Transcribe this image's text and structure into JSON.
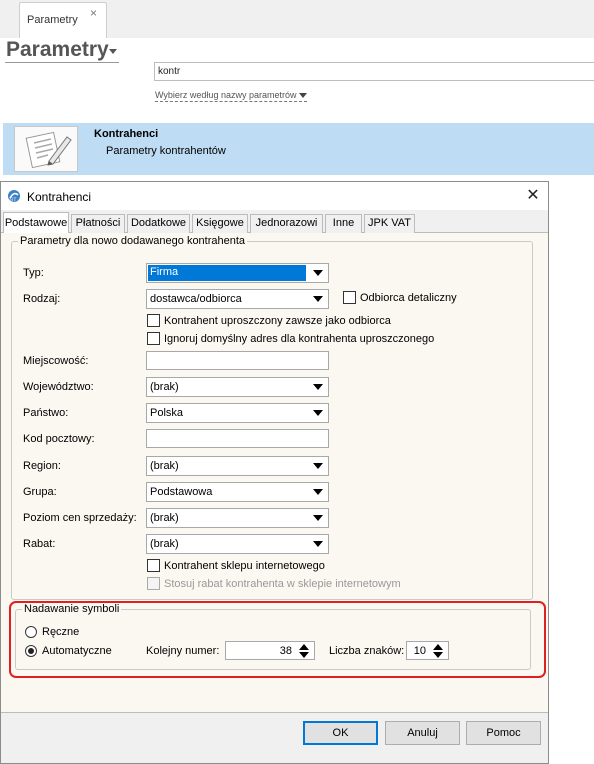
{
  "app": {
    "tab_label": "Parametry",
    "tab_close": "×",
    "page_title": "Parametry",
    "search_value": "kontr",
    "search_hint": "Wybierz według nazwy parametrów",
    "result": {
      "title": "Kontrahenci",
      "subtitle": "Parametry kontrahentów",
      "icon": "document-pen-icon"
    }
  },
  "dialog": {
    "title": "Kontrahenci",
    "close": "✕",
    "tabs": [
      {
        "label": "Podstawowe",
        "active": true
      },
      {
        "label": "Płatności",
        "active": false
      },
      {
        "label": "Dodatkowe",
        "active": false
      },
      {
        "label": "Księgowe",
        "active": false
      },
      {
        "label": "Jednorazowi",
        "active": false
      },
      {
        "label": "Inne",
        "active": false
      },
      {
        "label": "JPK VAT",
        "active": false
      }
    ],
    "group_new": {
      "legend": "Parametry dla nowo dodawanego kontrahenta",
      "fields": {
        "typ": {
          "label": "Typ:",
          "value": "Firma"
        },
        "rodzaj": {
          "label": "Rodzaj:",
          "value": "dostawca/odbiorca"
        },
        "miejscowosc": {
          "label": "Miejscowość:",
          "value": ""
        },
        "wojewodztwo": {
          "label": "Województwo:",
          "value": "(brak)"
        },
        "panstwo": {
          "label": "Państwo:",
          "value": "Polska"
        },
        "kod": {
          "label": "Kod pocztowy:",
          "value": ""
        },
        "region": {
          "label": "Region:",
          "value": "(brak)"
        },
        "grupa": {
          "label": "Grupa:",
          "value": "Podstawowa"
        },
        "poziom": {
          "label": "Poziom cen sprzedaży:",
          "value": "(brak)"
        },
        "rabat": {
          "label": "Rabat:",
          "value": "(brak)"
        }
      },
      "checkboxes": {
        "odbiorca_detaliczny": {
          "label": "Odbiorca detaliczny",
          "checked": false
        },
        "uproszczony": {
          "label": "Kontrahent uproszczony zawsze jako odbiorca",
          "checked": false
        },
        "ignoruj": {
          "label": "Ignoruj domyślny adres dla kontrahenta uproszczonego",
          "checked": false
        },
        "sklep": {
          "label": "Kontrahent sklepu internetowego",
          "checked": false
        },
        "rabat_sklep": {
          "label": "Stosuj rabat kontrahenta w sklepie internetowym",
          "checked": false,
          "disabled": true
        }
      }
    },
    "group_symbols": {
      "legend": "Nadawanie symboli",
      "radio_manual": "Ręczne",
      "radio_auto": "Automatyczne",
      "selected": "Automatyczne",
      "next_number_label": "Kolejny numer:",
      "next_number": "38",
      "chars_label": "Liczba znaków:",
      "chars": "10"
    },
    "buttons": {
      "ok": "OK",
      "cancel": "Anuluj",
      "help": "Pomoc"
    }
  },
  "colors": {
    "highlight": "#e02020",
    "selection": "#0078d7",
    "result_row": "#bedcf4",
    "panel": "#fbf8f2"
  }
}
